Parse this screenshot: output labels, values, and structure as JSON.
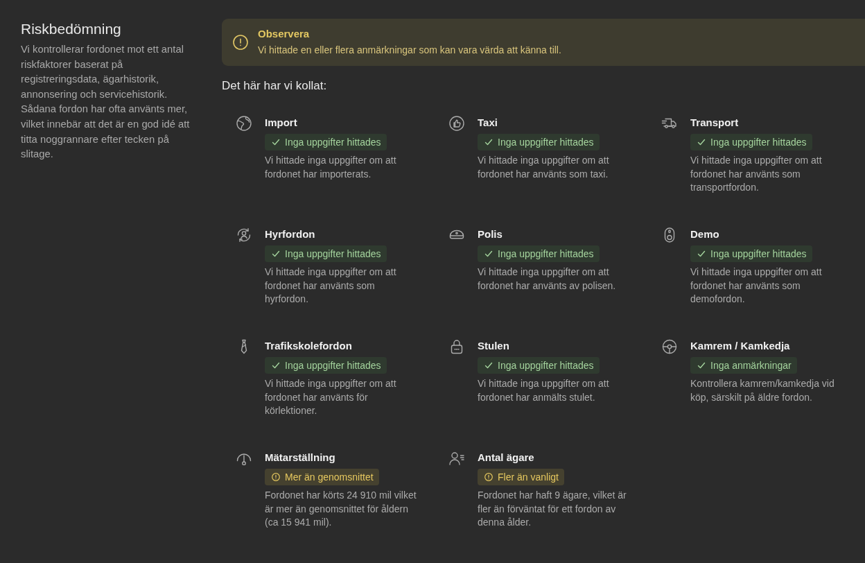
{
  "section": {
    "title": "Riskbedömning",
    "description": "Vi kontrollerar fordonet mot ett antal riskfaktorer baserat på registreringsdata, ägarhistorik, annonsering och servicehistorik. Sådana fordon har ofta använts mer, vilket innebär att det är en god idé att titta noggrannare efter tecken på slitage."
  },
  "notice": {
    "title": "Observera",
    "text": "Vi hittade en eller flera anmärkningar som kan vara värda att känna till."
  },
  "checklist": {
    "heading": "Det här har vi kollat:",
    "items": [
      {
        "title": "Import",
        "kind": "ok",
        "status": "Inga uppgifter hittades",
        "description": "Vi hittade inga uppgifter om att fordonet har importerats."
      },
      {
        "title": "Taxi",
        "kind": "ok",
        "status": "Inga uppgifter hittades",
        "description": "Vi hittade inga uppgifter om att fordonet har använts som taxi."
      },
      {
        "title": "Transport",
        "kind": "ok",
        "status": "Inga uppgifter hittades",
        "description": "Vi hittade inga uppgifter om att fordonet har använts som transportfordon."
      },
      {
        "title": "Hyrfordon",
        "kind": "ok",
        "status": "Inga uppgifter hittades",
        "description": "Vi hittade inga uppgifter om att fordonet har använts som hyrfordon."
      },
      {
        "title": "Polis",
        "kind": "ok",
        "status": "Inga uppgifter hittades",
        "description": "Vi hittade inga uppgifter om att fordonet har använts av polisen."
      },
      {
        "title": "Demo",
        "kind": "ok",
        "status": "Inga uppgifter hittades",
        "description": "Vi hittade inga uppgifter om att fordonet har använts som demofordon."
      },
      {
        "title": "Trafikskolefordon",
        "kind": "ok",
        "status": "Inga uppgifter hittades",
        "description": "Vi hittade inga uppgifter om att fordonet har använts för körlektioner."
      },
      {
        "title": "Stulen",
        "kind": "ok",
        "status": "Inga uppgifter hittades",
        "description": "Vi hittade inga uppgifter om att fordonet har anmälts stulet."
      },
      {
        "title": "Kamrem / Kamkedja",
        "kind": "ok",
        "status": "Inga anmärkningar",
        "description": "Kontrollera kamrem/kamkedja vid köp, särskilt på äldre fordon."
      },
      {
        "title": "Mätarställning",
        "kind": "warning",
        "status": "Mer än genomsnittet",
        "description": "Fordonet har körts 24 910 mil vilket är mer än genomsnittet för åldern (ca 15 941 mil)."
      },
      {
        "title": "Antal ägare",
        "kind": "warning",
        "status": "Fler än vanligt",
        "description": "Fordonet har haft 9 ägare, vilket är fler än förväntat för ett fordon av denna ålder."
      }
    ]
  }
}
